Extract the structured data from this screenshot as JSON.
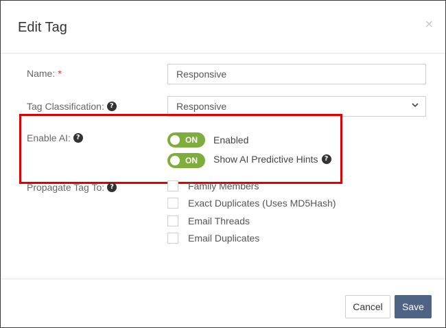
{
  "dialog": {
    "title": "Edit Tag",
    "close_glyph": "×",
    "close_icon": "close-icon"
  },
  "form": {
    "name": {
      "label": "Name:",
      "required_mark": "*",
      "value": "Responsive"
    },
    "classification": {
      "label": "Tag Classification:",
      "selected": "Responsive",
      "help_icon": "question-circle-icon"
    },
    "enable_ai": {
      "label": "Enable AI:",
      "help_icon": "question-circle-icon",
      "toggles": [
        {
          "state": "ON",
          "label": "Enabled"
        },
        {
          "state": "ON",
          "label": "Show AI Predictive Hints"
        }
      ],
      "toggle_color": "#7fad3c"
    },
    "propagate": {
      "label": "Propagate Tag To:",
      "help_icon": "question-circle-icon",
      "options": [
        {
          "label": "Family Members",
          "checked": false
        },
        {
          "label": "Exact Duplicates (Uses MD5Hash)",
          "checked": false
        },
        {
          "label": "Email Threads",
          "checked": false
        },
        {
          "label": "Email Duplicates",
          "checked": false
        }
      ]
    }
  },
  "footer": {
    "cancel_label": "Cancel",
    "save_label": "Save",
    "save_color": "#4f6384"
  },
  "annotation": {
    "highlight_color": "#e10000"
  }
}
